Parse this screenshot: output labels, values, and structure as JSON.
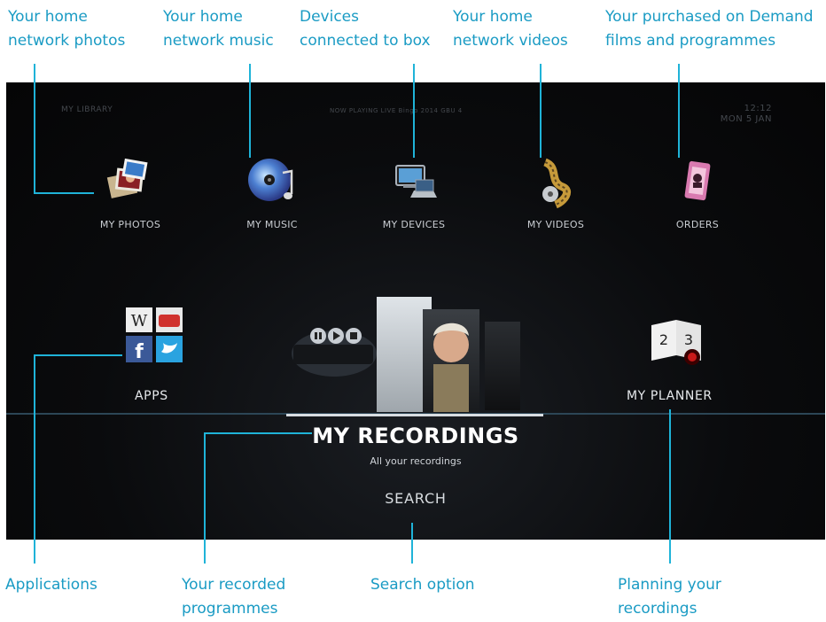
{
  "callouts": {
    "photos": [
      "Your home",
      "network photos"
    ],
    "music": [
      "Your home",
      "network music"
    ],
    "devices": [
      "Devices",
      "connected to box"
    ],
    "videos": [
      "Your home",
      "network videos"
    ],
    "orders": [
      "Your purchased on Demand",
      "films and programmes"
    ],
    "apps": "Applications",
    "recordings": [
      "Your recorded",
      "programmes"
    ],
    "search": "Search option",
    "planner": [
      "Planning your",
      "recordings"
    ]
  },
  "screen": {
    "section": "MY LIBRARY",
    "now_playing": "NOW PLAYING LIVE Bingo 2014 GBU 4",
    "time": "12:12",
    "date": "MON 5 JAN",
    "tiles": {
      "photos": "MY PHOTOS",
      "music": "MY MUSIC",
      "devices": "MY DEVICES",
      "videos": "MY VIDEOS",
      "orders": "ORDERS",
      "apps": "APPS",
      "planner": "MY PLANNER"
    },
    "recordings_title": "MY RECORDINGS",
    "recordings_subtitle": "All your recordings",
    "search": "SEARCH"
  },
  "colors": {
    "callout_text": "#1a9bc4",
    "callout_line": "#1fb3d8",
    "screen_bg": "#0a0b0d"
  }
}
